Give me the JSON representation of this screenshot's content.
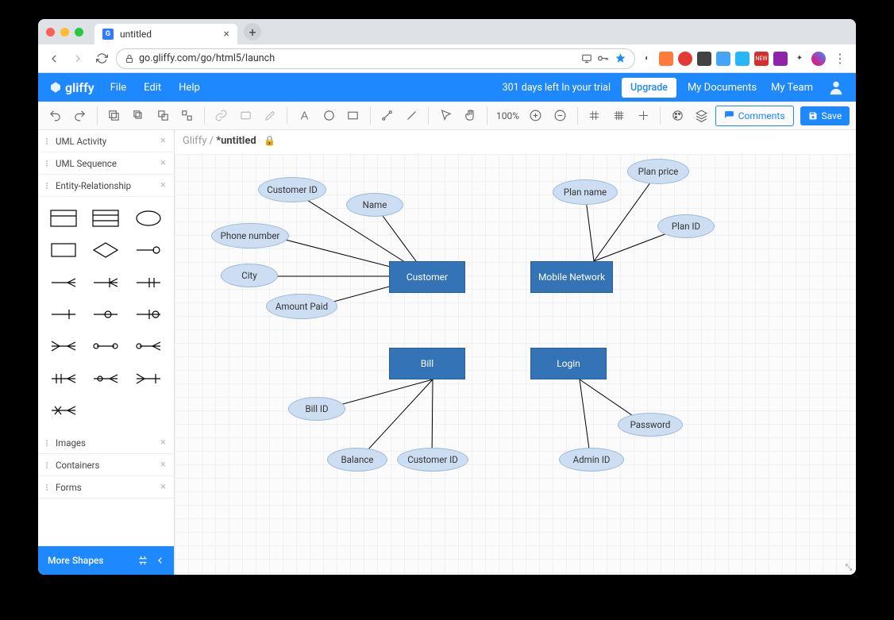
{
  "browser": {
    "tab_title": "untitled",
    "url": "go.gliffy.com/go/html5/launch"
  },
  "app": {
    "logo": "gliffy",
    "menu": {
      "file": "File",
      "edit": "Edit",
      "help": "Help"
    },
    "trial_text": "301 days left In your trial",
    "upgrade": "Upgrade",
    "my_documents": "My Documents",
    "my_team": "My Team"
  },
  "toolbar": {
    "zoom": "100%",
    "comments": "Comments",
    "save": "Save"
  },
  "sidebar": {
    "sections_top": [
      "UML Activity",
      "UML Sequence",
      "Entity-Relationship"
    ],
    "sections_bottom": [
      "Images",
      "Containers",
      "Forms"
    ],
    "more_shapes": "More Shapes"
  },
  "breadcrumb": {
    "root": "Gliffy /",
    "doc": "*untitled"
  },
  "diagram": {
    "entities": {
      "customer": "Customer",
      "mobile_network": "Mobile Network",
      "bill": "Bill",
      "login": "Login"
    },
    "attributes": {
      "customer_id": "Customer ID",
      "name": "Name",
      "phone_number": "Phone number",
      "city": "City",
      "amount_paid": "Amount Paid",
      "plan_name": "Plan name",
      "plan_price": "Plan price",
      "plan_id": "Plan ID",
      "bill_id": "Bill ID",
      "balance": "Balance",
      "customer_id2": "Customer ID",
      "admin_id": "Admin ID",
      "password": "Password"
    }
  }
}
